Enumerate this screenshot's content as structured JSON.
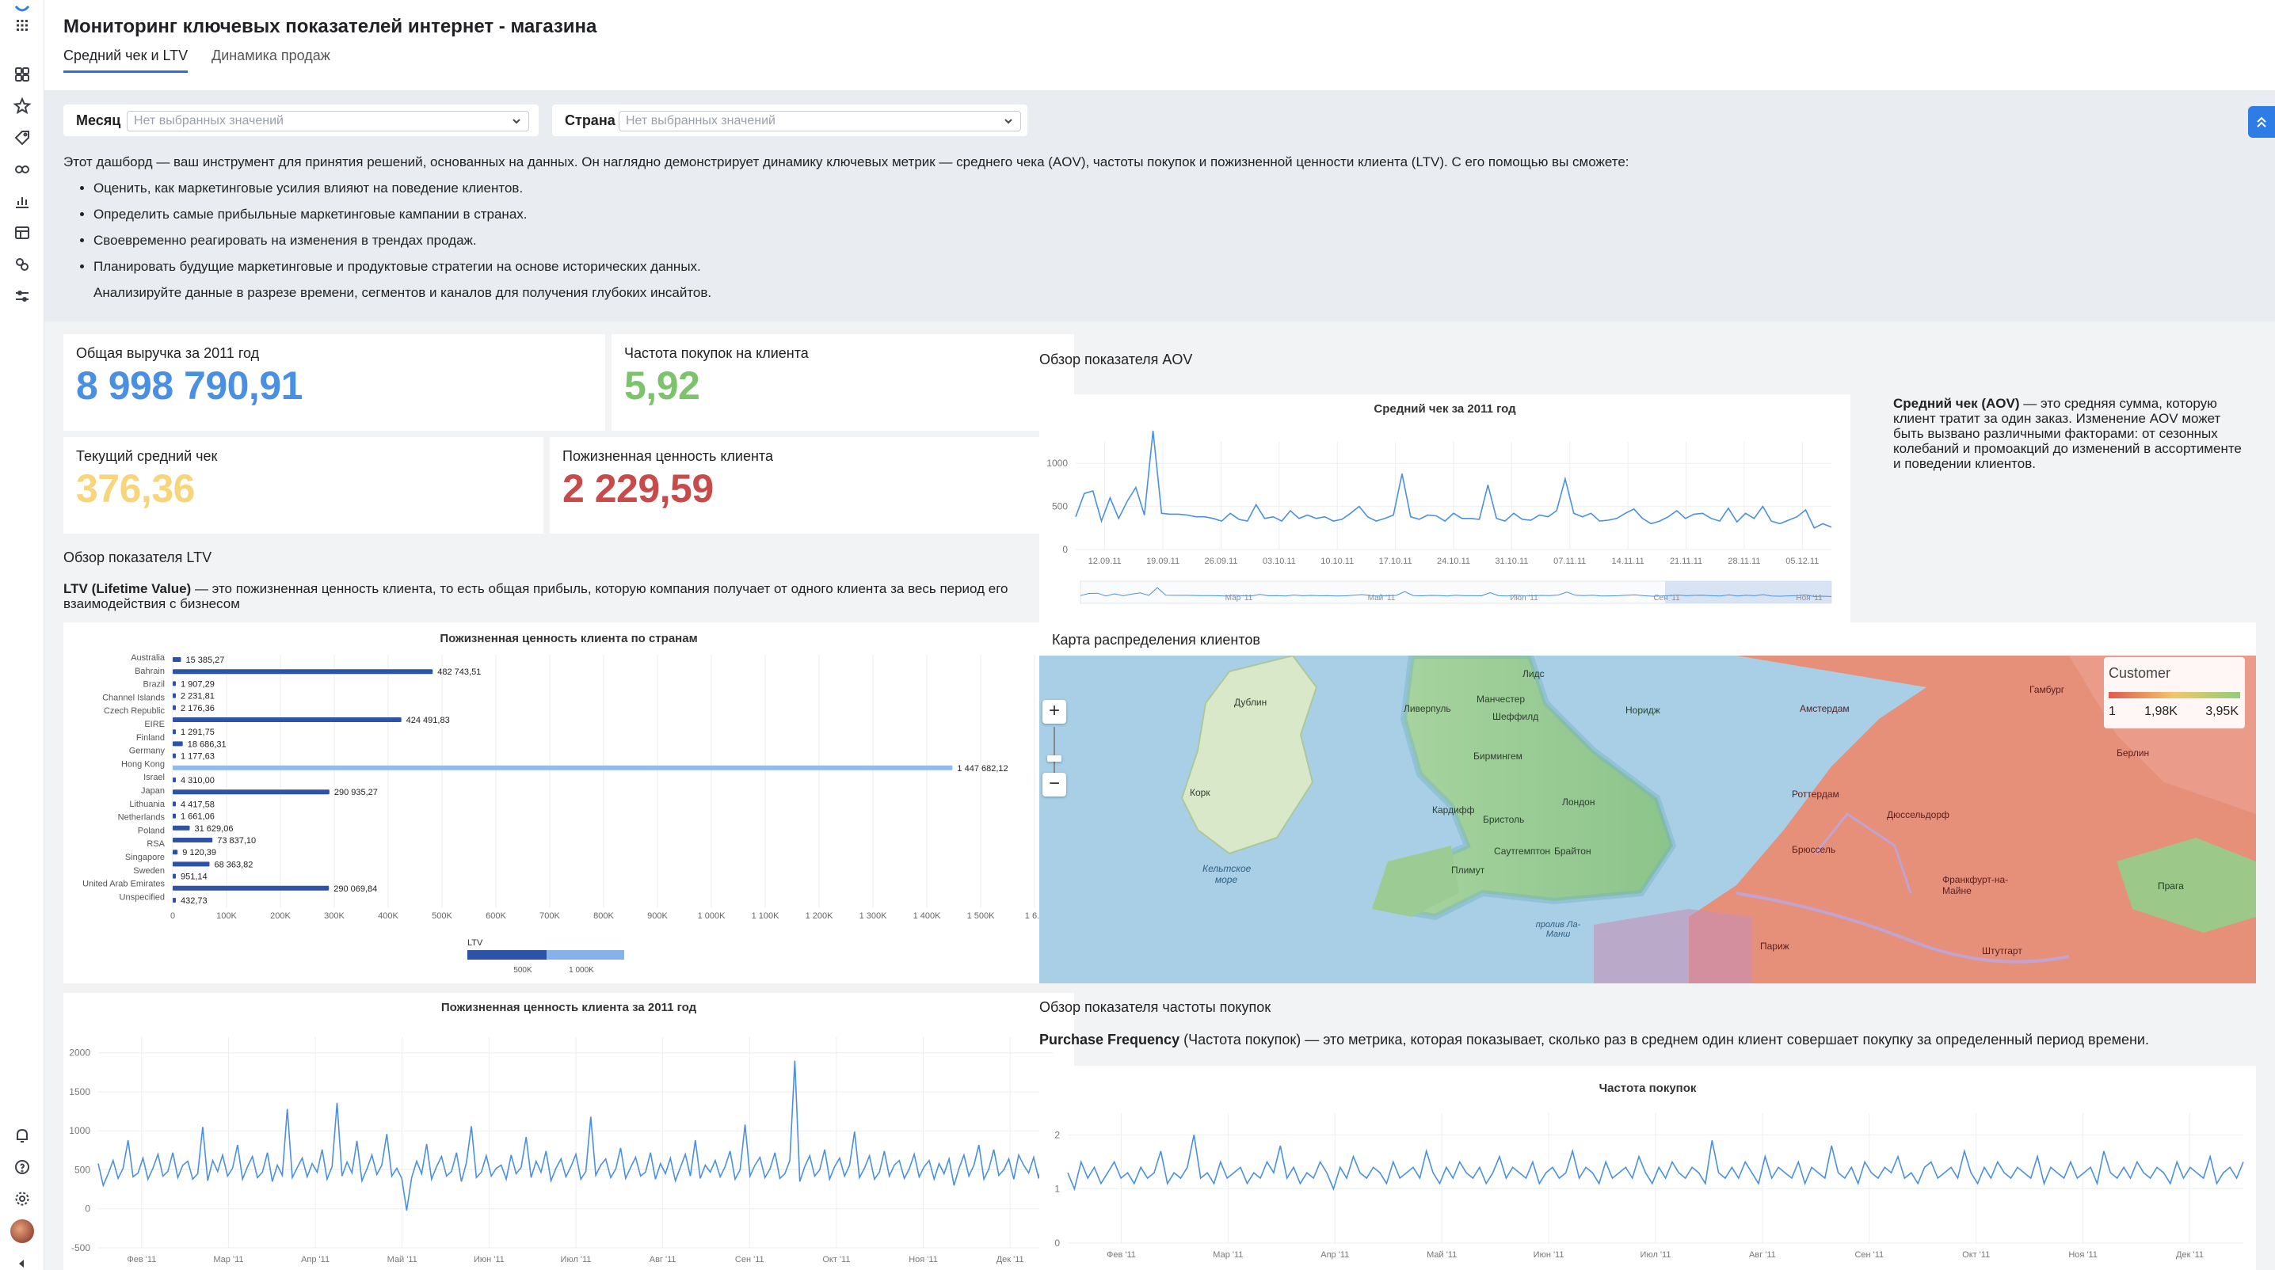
{
  "header": {
    "title": "Мониторинг ключевых показателей интернет - магазина",
    "tabs": [
      {
        "label": "Средний чек и LTV",
        "active": true
      },
      {
        "label": "Динамика продаж",
        "active": false
      }
    ]
  },
  "filters": {
    "month": {
      "label": "Месяц",
      "placeholder": "Нет выбранных значений"
    },
    "country": {
      "label": "Страна",
      "placeholder": "Нет выбранных значений"
    }
  },
  "intro": {
    "paragraph": "Этот дашборд — ваш инструмент для принятия решений, основанных на данных. Он наглядно демонстрирует динамику ключевых метрик — среднего чека (AOV), частоты покупок и пожизненной ценности клиента (LTV). С его помощью вы сможете:",
    "bullets": [
      "Оценить, как маркетинговые усилия влияют на поведение клиентов.",
      "Определить самые прибыльные маркетинговые кампании в странах.",
      "Своевременно реагировать на изменения в трендах продаж.",
      "Планировать будущие маркетинговые и продуктовые стратегии на основе исторических данных."
    ],
    "footer": "Анализируйте данные в разрезе времени, сегментов и каналов для получения глубоких инсайтов."
  },
  "kpis": {
    "revenue": {
      "label": "Общая выручка за 2011 год",
      "value": "8 998 790,91",
      "color": "#4a90e2"
    },
    "frequency": {
      "label": "Частота покупок на клиента",
      "value": "5,92",
      "color": "#7dc36b"
    },
    "aov": {
      "label": "Текущий средний чек",
      "value": "376,36",
      "color": "#f7d57a"
    },
    "ltv": {
      "label": "Пожизненная ценность клиента",
      "value": "2 229,59",
      "color": "#c94a4a"
    }
  },
  "ltv_section": {
    "title": "Обзор показателя LTV",
    "desc_bold": "LTV (Lifetime Value)",
    "desc": " — это пожизненная ценность клиента, то есть общая прибыль, которую компания получает от одного клиента за весь период его взаимодействия с бизнесом"
  },
  "aov_section": {
    "title": "Обзор показателя AOV",
    "desc_bold": "Средний чек (AOV)",
    "desc": " — это средняя сумма, которую клиент тратит за один заказ. Изменение AOV может быть вызвано различными факторами: от сезонных колебаний и промоакций до изменений в ассортименте и поведении клиентов."
  },
  "map_section": {
    "title": "Карта распределения клиентов",
    "legend_title": "Customer",
    "legend_labels": [
      "1",
      "1,98K",
      "3,95K"
    ],
    "labels": {
      "sea_celtic": "Кельтское море",
      "la_manche": "пролив Ла-Манш",
      "dublin": "Дублин",
      "liverpool": "Ливерпуль",
      "manchester": "Манчестер",
      "sheffield": "Шеффилд",
      "birmingham": "Бирмингем",
      "london": "Лондон",
      "cardiff": "Кардифф",
      "bristol": "Бристоль",
      "southampton": "Саутгемптон",
      "brighton": "Брайтон",
      "amsterdam": "Амстердам",
      "rotterdam": "Роттердам",
      "brussels": "Брюссель",
      "paris": "Париж",
      "hamburg": "Гамбург",
      "berlin": "Берлин",
      "dusseldorf": "Дюссельдорф",
      "frankfurt": "Франкфурт-на-Майне",
      "prague": "Прага",
      "stuttgart": "Штутгарт",
      "cork": "Корк",
      "plymouth": "Плимут",
      "leeds": "Лидс",
      "norwich": "Норидж"
    },
    "zoom_in": "+",
    "zoom_out": "−"
  },
  "freq_section": {
    "title": "Обзор показателя частоты покупок",
    "desc_bold": "Purchase Frequency",
    "desc": " (Частота покупок) — это метрика, которая показывает, сколько раз в среднем один клиент совершает покупку за определенный период времени."
  },
  "chart_data": [
    {
      "type": "line",
      "title": "Средний чек за 2011 год",
      "x": [
        "12.09.11",
        "19.09.11",
        "26.09.11",
        "03.10.11",
        "10.10.11",
        "17.10.11",
        "24.10.11",
        "31.10.11",
        "07.11.11",
        "14.11.11",
        "21.11.11",
        "28.11.11",
        "05.12.11"
      ],
      "ylim": [
        0,
        1250
      ],
      "yticks": [
        0,
        500,
        1000
      ],
      "navigator_labels": [
        "Мар '11",
        "Май '11",
        "Июл '11",
        "Сен '11",
        "Ноя '11"
      ],
      "series": [
        {
          "values": [
            380,
            650,
            680,
            330,
            600,
            360,
            560,
            720,
            400,
            1380,
            420,
            410,
            410,
            400,
            380,
            380,
            360,
            330,
            420,
            350,
            330,
            520,
            360,
            380,
            330,
            450,
            360,
            400,
            360,
            380,
            330,
            350,
            420,
            500,
            380,
            330,
            360,
            400,
            880,
            380,
            350,
            400,
            390,
            330,
            420,
            360,
            360,
            350,
            750,
            360,
            330,
            420,
            350,
            340,
            400,
            380,
            450,
            820,
            420,
            380,
            420,
            330,
            340,
            360,
            420,
            470,
            360,
            300,
            330,
            380,
            450,
            360,
            410,
            420,
            360,
            330,
            480,
            320,
            420,
            360,
            500,
            330,
            300,
            340,
            380,
            460,
            250,
            300,
            260
          ]
        }
      ]
    },
    {
      "type": "bar",
      "title": "Пожизненная ценность клиента по странам",
      "categories": [
        "Australia",
        "Bahrain",
        "Brazil",
        "Channel Islands",
        "Czech Republic",
        "EIRE",
        "Finland",
        "Germany",
        "Hong Kong",
        "Israel",
        "Japan",
        "Lithuania",
        "Netherlands",
        "Poland",
        "RSA",
        "Singapore",
        "Sweden",
        "United Arab Emirates",
        "Unspecified"
      ],
      "values": [
        15385.27,
        482743.51,
        1907.29,
        2231.81,
        2176.36,
        424491.83,
        1291.75,
        18686.31,
        1177.63,
        1447682.12,
        4310.0,
        290935.27,
        4417.58,
        1661.06,
        31629.06,
        73837.1,
        9120.39,
        68363.82,
        951.14,
        290069.84,
        432.73
      ],
      "value_labels": [
        "15 385,27",
        "482 743,51",
        "1 907,29",
        "2 231,81",
        "2 176,36",
        "424 491,83",
        "1 291,75",
        "18 686,31",
        "1 177,63",
        "1 447 682,12",
        "4 310,00",
        "290 935,27",
        "4 417,58",
        "1 661,06",
        "31 629,06",
        "73 837,10",
        "9 120,39",
        "68 363,82",
        "951,14",
        "290 069,84",
        "432,73"
      ],
      "xticks": [
        "0",
        "100K",
        "200K",
        "300K",
        "400K",
        "500K",
        "600K",
        "700K",
        "800K",
        "900K",
        "1 000K",
        "1 100K",
        "1 200K",
        "1 300K",
        "1 400K",
        "1 500K",
        "1 6..."
      ],
      "xlim": [
        0,
        1600000
      ],
      "legend_title": "LTV",
      "legend_ticks": [
        "500K",
        "1 000K"
      ]
    },
    {
      "type": "line",
      "title": "Пожизненная ценность клиента за 2011 год",
      "x": [
        "Фев '11",
        "Мар '11",
        "Апр '11",
        "Май '11",
        "Июн '11",
        "Июл '11",
        "Авг '11",
        "Сен '11",
        "Окт '11",
        "Ноя '11",
        "Дек '11"
      ],
      "ylim": [
        -500,
        2200
      ],
      "yticks": [
        -500,
        0,
        500,
        1000,
        1500,
        2000
      ],
      "series": [
        {
          "values": [
            580,
            300,
            450,
            620,
            390,
            520,
            880,
            410,
            460,
            650,
            380,
            520,
            700,
            420,
            480,
            720,
            400,
            560,
            610,
            380,
            450,
            1050,
            360,
            620,
            480,
            690,
            420,
            520,
            820,
            380,
            540,
            670,
            400,
            470,
            720,
            350,
            560,
            430,
            1280,
            400,
            530,
            650,
            410,
            580,
            470,
            760,
            380,
            540,
            1360,
            420,
            600,
            460,
            870,
            360,
            510,
            690,
            440,
            560,
            960,
            420,
            520,
            390,
            -20,
            400,
            610,
            450,
            830,
            380,
            540,
            670,
            420,
            480,
            720,
            350,
            590,
            1060,
            400,
            470,
            680,
            420,
            520,
            560,
            380,
            690,
            450,
            530,
            920,
            400,
            610,
            470,
            740,
            360,
            520,
            640,
            410,
            540,
            700,
            380,
            480,
            1180,
            430,
            560,
            640,
            400,
            510,
            780,
            390,
            530,
            660,
            420,
            470,
            720,
            380,
            580,
            450,
            650,
            360,
            530,
            700,
            420,
            880,
            390,
            560,
            470,
            620,
            410,
            540,
            740,
            380,
            500,
            1080,
            420,
            560,
            660,
            400,
            510,
            720,
            390,
            450,
            620,
            1900,
            350,
            540,
            680,
            420,
            500,
            760,
            380,
            540,
            650,
            420,
            560,
            990,
            400,
            520,
            680,
            380,
            470,
            740,
            420,
            560,
            620,
            390,
            510,
            700,
            410,
            540,
            620,
            380,
            580,
            450,
            640,
            300,
            520,
            690,
            420,
            560,
            820,
            380,
            510,
            760,
            430,
            500,
            640,
            380,
            690,
            560,
            460,
            660,
            390,
            720,
            540,
            420
          ]
        }
      ]
    },
    {
      "type": "line",
      "title": "Частота покупок",
      "x": [
        "Фев '11",
        "Мар '11",
        "Апр '11",
        "Май '11",
        "Июн '11",
        "Июл '11",
        "Авг '11",
        "Сен '11",
        "Окт '11",
        "Ноя '11",
        "Дек '11"
      ],
      "ylim": [
        0,
        2.4
      ],
      "yticks": [
        0,
        1,
        2
      ],
      "series": [
        {
          "values": [
            1.3,
            1.0,
            1.5,
            1.2,
            1.4,
            1.1,
            1.3,
            1.5,
            1.2,
            1.3,
            1.1,
            1.4,
            1.2,
            1.3,
            1.7,
            1.1,
            1.3,
            1.2,
            1.4,
            2.0,
            1.2,
            1.3,
            1.1,
            1.5,
            1.2,
            1.3,
            1.4,
            1.1,
            1.3,
            1.2,
            1.5,
            1.3,
            1.8,
            1.2,
            1.4,
            1.1,
            1.3,
            1.2,
            1.5,
            1.3,
            1.0,
            1.4,
            1.2,
            1.6,
            1.3,
            1.2,
            1.4,
            1.3,
            1.1,
            1.5,
            1.2,
            1.3,
            1.4,
            1.2,
            1.7,
            1.3,
            1.1,
            1.4,
            1.2,
            1.5,
            1.3,
            1.2,
            1.4,
            1.1,
            1.3,
            1.6,
            1.2,
            1.4,
            1.3,
            1.2,
            1.5,
            1.1,
            1.3,
            1.4,
            1.2,
            1.3,
            1.7,
            1.2,
            1.4,
            1.3,
            1.1,
            1.5,
            1.2,
            1.3,
            1.4,
            1.2,
            1.6,
            1.3,
            1.1,
            1.4,
            1.2,
            1.5,
            1.3,
            1.2,
            1.4,
            1.3,
            1.1,
            1.9,
            1.3,
            1.2,
            1.4,
            1.2,
            1.5,
            1.3,
            1.1,
            1.6,
            1.2,
            1.4,
            1.3,
            1.2,
            1.5,
            1.1,
            1.4,
            1.3,
            1.2,
            1.8,
            1.3,
            1.2,
            1.4,
            1.1,
            1.5,
            1.3,
            1.2,
            1.4,
            1.3,
            1.6,
            1.2,
            1.3,
            1.1,
            1.4,
            1.5,
            1.2,
            1.3,
            1.4,
            1.2,
            1.7,
            1.3,
            1.1,
            1.4,
            1.2,
            1.5,
            1.3,
            1.2,
            1.4,
            1.3,
            1.2,
            1.6,
            1.1,
            1.4,
            1.3,
            1.2,
            1.5,
            1.2,
            1.3,
            1.4,
            1.1,
            1.7,
            1.3,
            1.2,
            1.4,
            1.2,
            1.5,
            1.3,
            1.2,
            1.4,
            1.3,
            1.1,
            1.5,
            1.2,
            1.4,
            1.3,
            1.2,
            1.6,
            1.1,
            1.3,
            1.4,
            1.2,
            1.5
          ]
        }
      ]
    }
  ],
  "colors": {
    "accent": "#2e7de6",
    "line": "#4a90e2",
    "bar_dark": "#2c53a8",
    "bar_light": "#8fbcf0"
  }
}
